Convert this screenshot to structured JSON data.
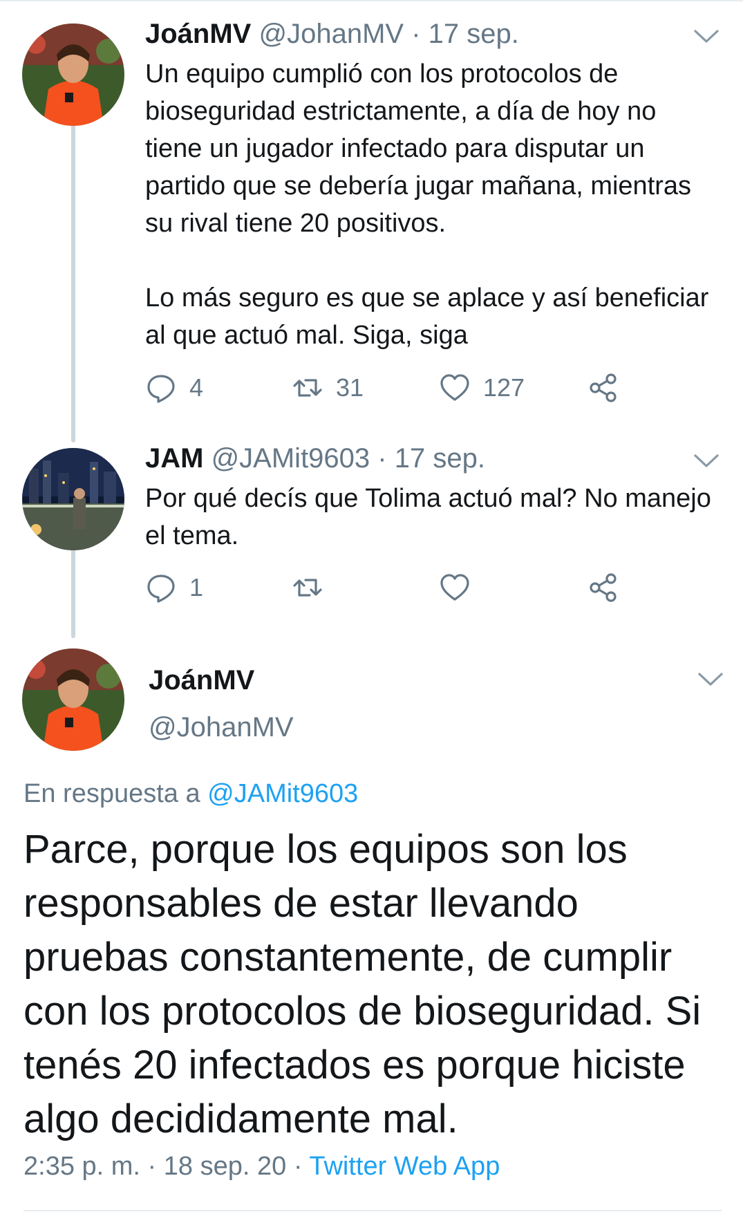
{
  "tweets": [
    {
      "name": "JoánMV",
      "handle": "@JohanMV",
      "separator": "·",
      "date": "17 sep.",
      "paragraphs": [
        "Un equipo cumplió con los protocolos de bioseguridad estrictamente, a día de hoy no tiene un jugador infectado para disputar un partido que se debería jugar mañana, mientras su rival tiene 20 positivos.",
        "Lo más seguro es que se aplace y así beneficiar al que actuó mal. Siga, siga"
      ],
      "replies": "4",
      "retweets": "31",
      "likes": "127"
    },
    {
      "name": "JAM",
      "handle": "@JAMit9603",
      "separator": "·",
      "date": "17 sep.",
      "paragraphs": [
        "Por qué decís que Tolima actuó mal? No manejo el tema."
      ],
      "replies": "1",
      "retweets": "",
      "likes": ""
    }
  ],
  "main": {
    "name": "JoánMV",
    "handle": "@JohanMV",
    "reply_prefix": "En respuesta a",
    "reply_mention": "@JAMit9603",
    "text": "Parce, porque los equipos son los responsables de estar llevando pruebas constantemente, de cumplir con los protocolos de bioseguridad. Si tenés 20 infectados es porque hiciste algo decididamente mal.",
    "time": "2:35 p. m.",
    "separator": "·",
    "date": "18 sep. 20",
    "app": "Twitter Web App"
  },
  "colors": {
    "text": "#14171a",
    "secondary": "#657786",
    "accent": "#1da1f2",
    "thread_line": "#ccd6dd"
  },
  "icons": [
    "chevron-down-icon",
    "reply-icon",
    "retweet-icon",
    "like-icon",
    "share-icon"
  ]
}
